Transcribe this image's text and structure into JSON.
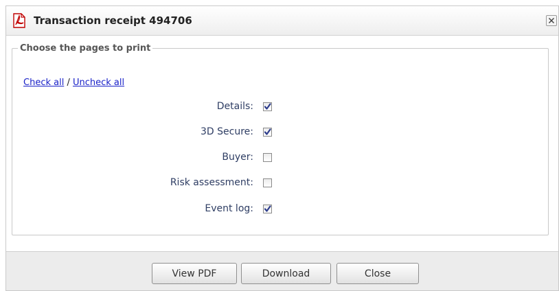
{
  "dialog": {
    "title": "Transaction receipt 494706",
    "icon": "pdf-icon",
    "close_icon": "close-icon",
    "accent_color": "#cc0000"
  },
  "fieldset": {
    "legend": "Choose the pages to print",
    "check_all": "Check all",
    "separator": "/",
    "uncheck_all": "Uncheck all"
  },
  "pages": [
    {
      "label": "Details:",
      "checked": true
    },
    {
      "label": "3D Secure:",
      "checked": true
    },
    {
      "label": "Buyer:",
      "checked": false
    },
    {
      "label": "Risk assessment:",
      "checked": false
    },
    {
      "label": "Event log:",
      "checked": true
    }
  ],
  "buttons": {
    "view_pdf": "View PDF",
    "download": "Download",
    "close": "Close"
  }
}
